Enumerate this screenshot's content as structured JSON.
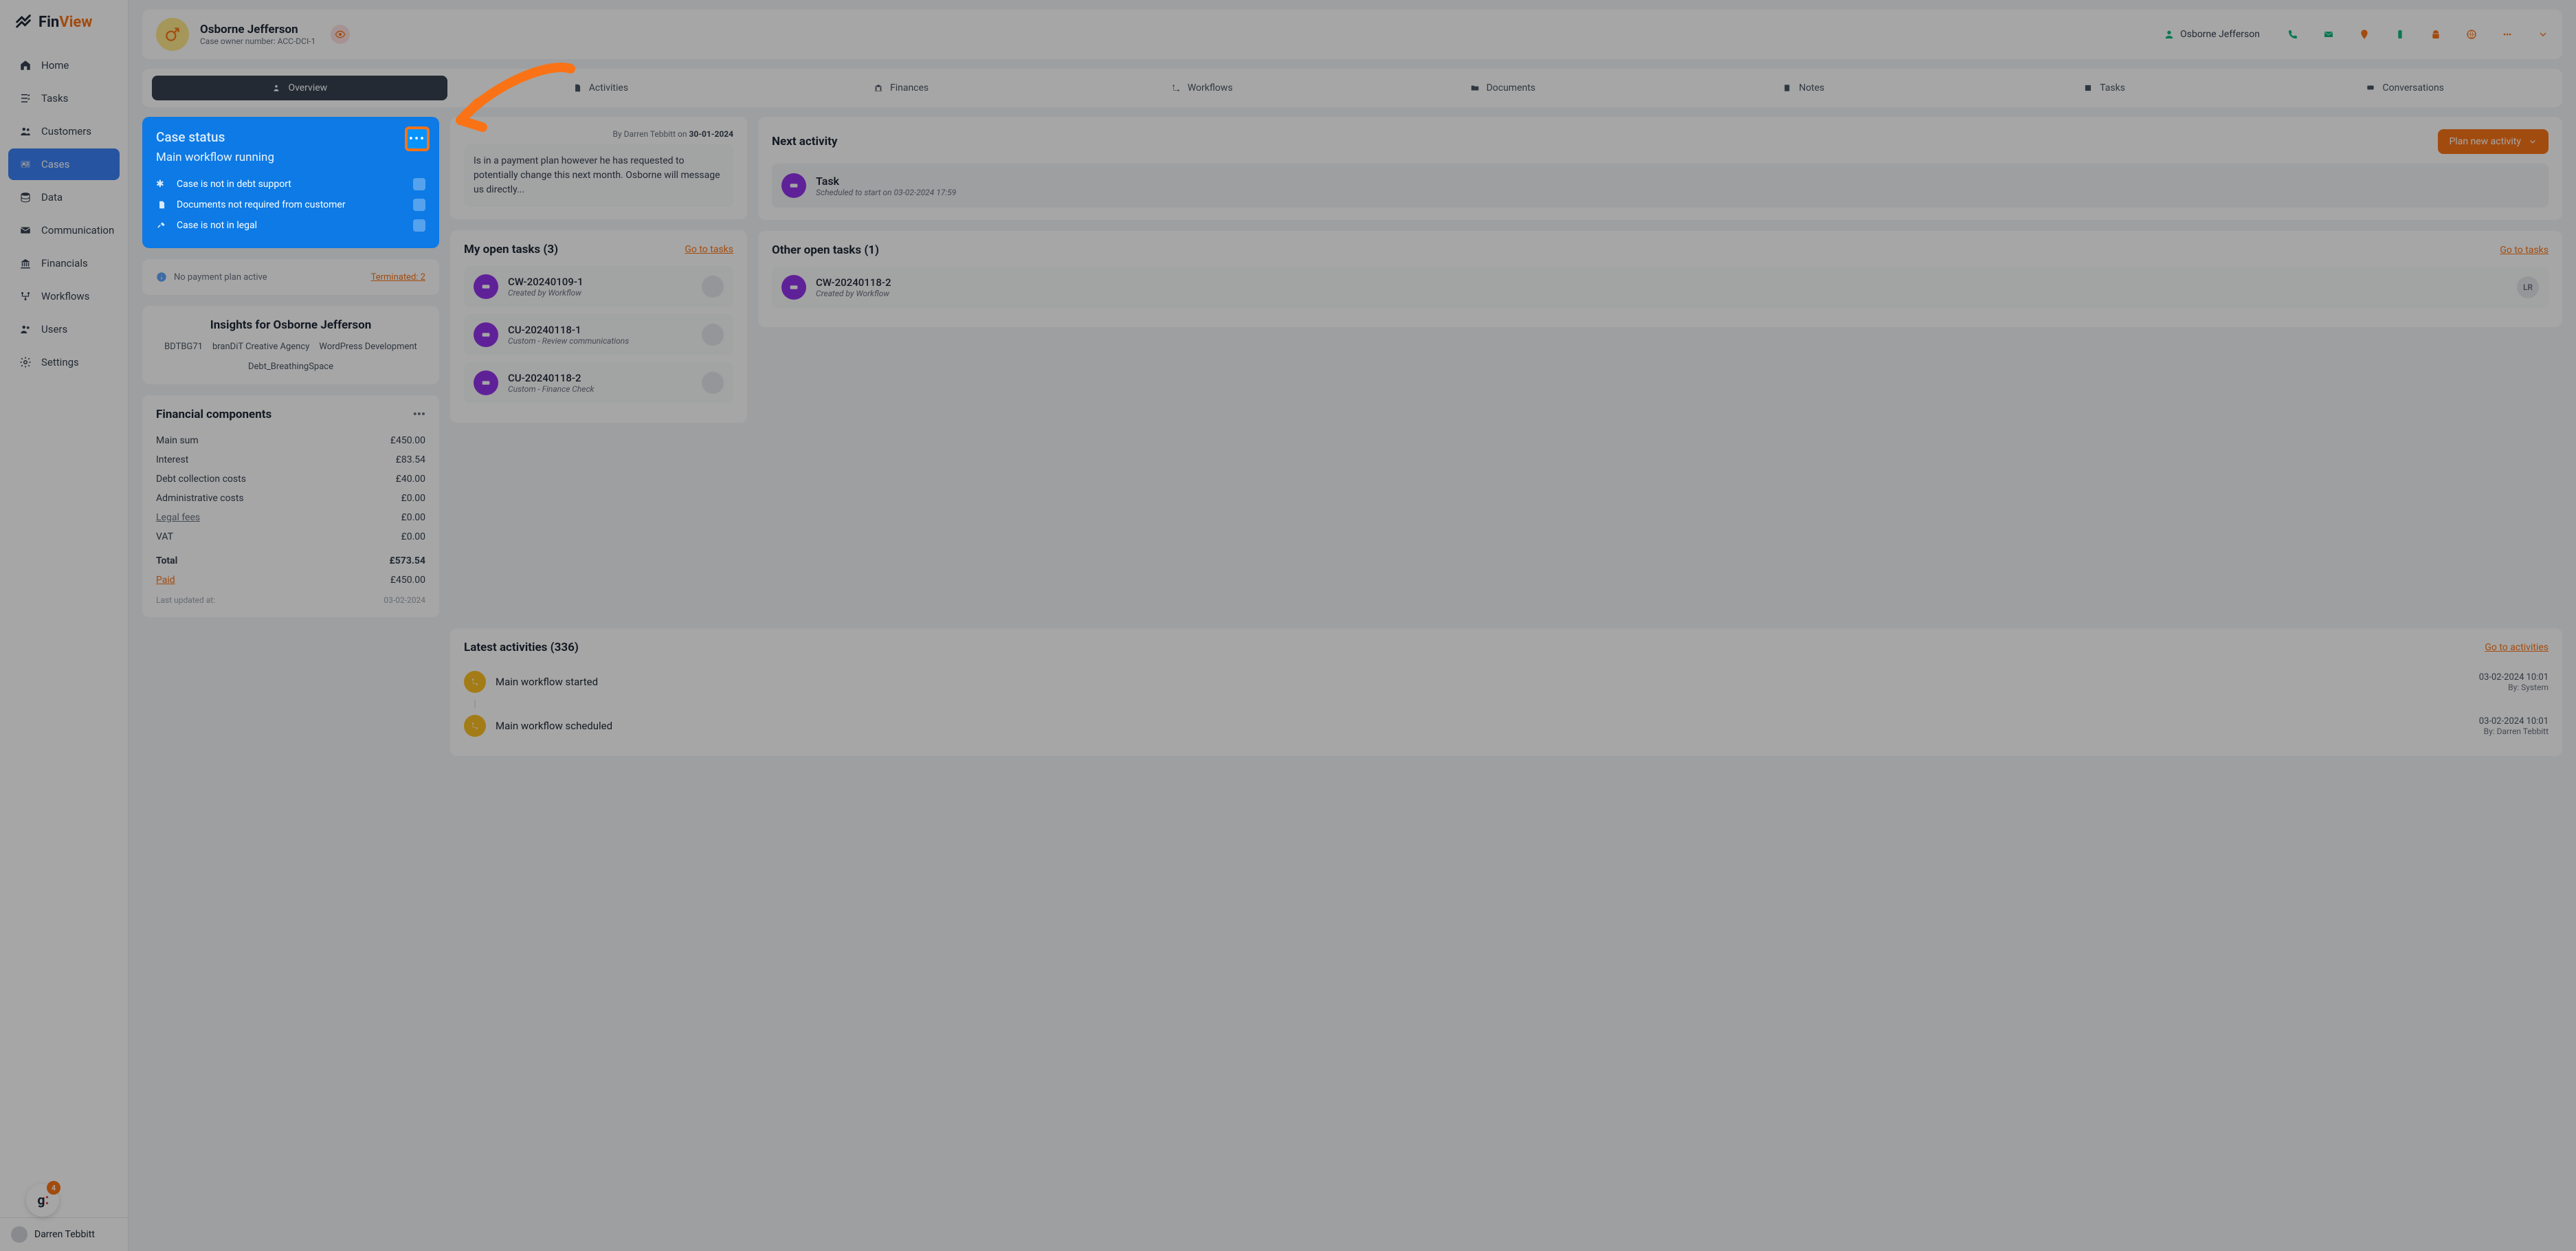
{
  "brand": {
    "name_prefix": "Fin",
    "name_suffix": "View"
  },
  "sidebar": {
    "items": [
      {
        "label": "Home"
      },
      {
        "label": "Tasks"
      },
      {
        "label": "Customers"
      },
      {
        "label": "Cases"
      },
      {
        "label": "Data"
      },
      {
        "label": "Communication"
      },
      {
        "label": "Financials"
      },
      {
        "label": "Workflows"
      },
      {
        "label": "Users"
      },
      {
        "label": "Settings"
      }
    ],
    "footer_user": "Darren Tebbitt",
    "bubble_count": "4"
  },
  "header": {
    "name": "Osborne Jefferson",
    "subtitle": "Case owner number: ACC-DCI-1",
    "user": "Osborne Jefferson"
  },
  "tabs": [
    {
      "label": "Overview"
    },
    {
      "label": "Activities"
    },
    {
      "label": "Finances"
    },
    {
      "label": "Workflows"
    },
    {
      "label": "Documents"
    },
    {
      "label": "Notes"
    },
    {
      "label": "Tasks"
    },
    {
      "label": "Conversations"
    }
  ],
  "case_status": {
    "title": "Case status",
    "subtitle": "Main workflow running",
    "rows": [
      {
        "text": "Case is not in debt support"
      },
      {
        "text": "Documents not required from customer"
      },
      {
        "text": "Case is not in legal"
      }
    ]
  },
  "payment_info": {
    "text": "No payment plan active",
    "link": "Terminated: 2"
  },
  "insights": {
    "title": "Insights for Osborne Jefferson",
    "tags": [
      "BDTBG71",
      "branDiT Creative Agency",
      "WordPress Development",
      "Debt_BreathingSpace"
    ]
  },
  "fin": {
    "title": "Financial components",
    "rows": [
      {
        "label": "Main sum",
        "value": "£450.00"
      },
      {
        "label": "Interest",
        "value": "£83.54"
      },
      {
        "label": "Debt collection costs",
        "value": "£40.00"
      },
      {
        "label": "Administrative costs",
        "value": "£0.00"
      },
      {
        "label": "Legal fees",
        "value": "£0.00",
        "underline": true
      },
      {
        "label": "VAT",
        "value": "£0.00"
      }
    ],
    "total_label": "Total",
    "total_value": "£573.54",
    "paid_label": "Paid",
    "paid_value": "£450.00",
    "footer_label": "Last updated at:",
    "footer_value": "03-02-2024"
  },
  "last_note": {
    "by": "By Darren Tebbitt on ",
    "date": "30-01-2024",
    "body": "Is in a payment plan however he has requested to potentially change this next month. Osborne will message us directly..."
  },
  "my_tasks": {
    "title": "My open tasks (3)",
    "link": "Go to tasks",
    "items": [
      {
        "id": "CW-20240109-1",
        "sub": "Created by Workflow"
      },
      {
        "id": "CU-20240118-1",
        "sub": "Custom - Review communications"
      },
      {
        "id": "CU-20240118-2",
        "sub": "Custom - Finance Check"
      }
    ]
  },
  "next_activity": {
    "title": "Next activity",
    "button": "Plan new activity",
    "item_title": "Task",
    "item_sub": "Scheduled to start on 03-02-2024 17:59"
  },
  "other_tasks": {
    "title": "Other open tasks (1)",
    "link": "Go to tasks",
    "items": [
      {
        "id": "CW-20240118-2",
        "sub": "Created by Workflow",
        "initials": "LR"
      }
    ]
  },
  "latest": {
    "title": "Latest activities (336)",
    "link": "Go to activities",
    "items": [
      {
        "title": "Main workflow started",
        "date": "03-02-2024 10:01",
        "by": "By: System"
      },
      {
        "title": "Main workflow scheduled",
        "date": "03-02-2024 10:01",
        "by": "By: Darren Tebbitt"
      }
    ]
  }
}
